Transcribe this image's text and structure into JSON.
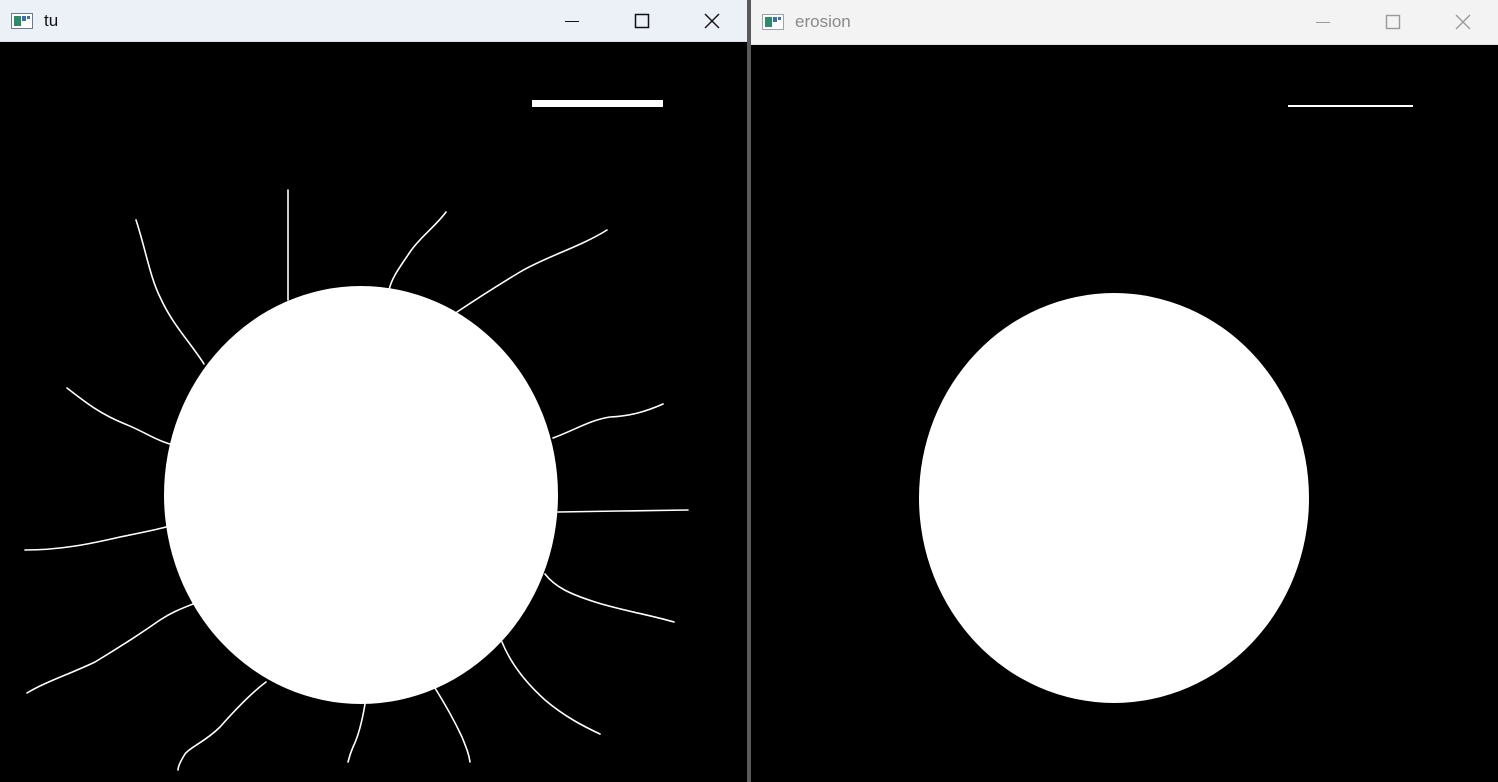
{
  "windows": {
    "tu": {
      "title": "tu",
      "icon": "image-window-icon",
      "active": true
    },
    "erosion": {
      "title": "erosion",
      "icon": "image-window-icon",
      "active": false
    }
  },
  "colors": {
    "image_background": "#000000",
    "image_foreground": "#ffffff",
    "active_titlebar": "#ecf1f8",
    "inactive_titlebar": "#f3f3f3",
    "active_glyph": "#111111",
    "inactive_glyph": "#8a8a8a"
  }
}
